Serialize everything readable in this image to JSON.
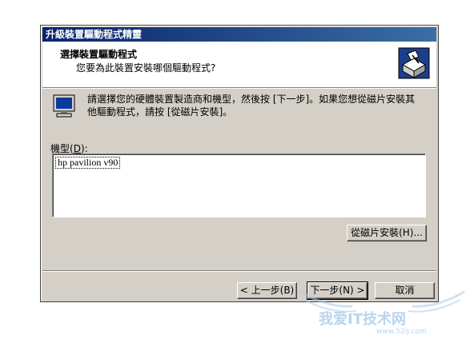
{
  "window": {
    "title": "升級裝置驅動程式精靈"
  },
  "header": {
    "title": "選擇裝置驅動程式",
    "subtitle": "您要為此裝置安裝哪個驅動程式?",
    "icon": "hardware-wizard-icon"
  },
  "body": {
    "icon": "monitor-icon",
    "instruction": "請選擇您的硬體裝置製造商和機型，然後按 [下一步]。如果您想從磁片安裝其他驅動程式，請按 [從磁片安裝]。"
  },
  "model": {
    "label_prefix": "機型(",
    "label_hotkey": "D",
    "label_suffix": "):",
    "items": [
      "hp pavilion v90"
    ]
  },
  "buttons": {
    "have_disk": "從磁片安裝(H)...",
    "back": "< 上一步(B)",
    "next": "下一步(N) >",
    "cancel": "取消"
  },
  "watermark": {
    "text": "我爱IT技术网",
    "url": "www.52ij.com"
  }
}
